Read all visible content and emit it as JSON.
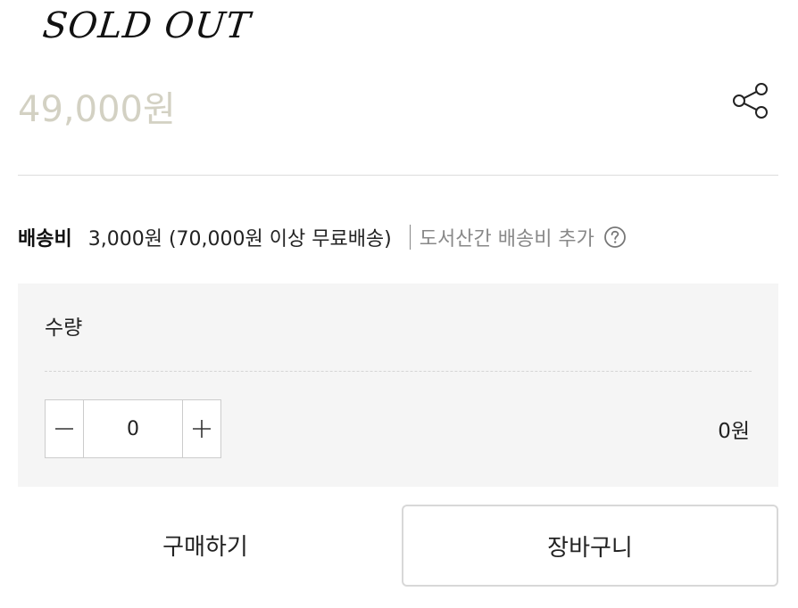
{
  "product": {
    "status_text": "SOLD OUT",
    "price": "49,000원"
  },
  "share": {
    "icon": "share-icon"
  },
  "shipping": {
    "label": "배송비",
    "fee_text": "3,000원 (70,000원 이상 무료배송)",
    "extra_text": "도서산간 배송비 추가",
    "help_icon": "question-circle-icon"
  },
  "quantity": {
    "title": "수량",
    "value": "0",
    "minus_icon": "minus-icon",
    "plus_icon": "plus-icon",
    "total": "0원"
  },
  "actions": {
    "buy_label": "구매하기",
    "cart_label": "장바구니"
  },
  "colors": {
    "price": "#d3d1c3",
    "panel_bg": "#f5f5f5",
    "muted_text": "#888888",
    "border": "#cccccc"
  }
}
